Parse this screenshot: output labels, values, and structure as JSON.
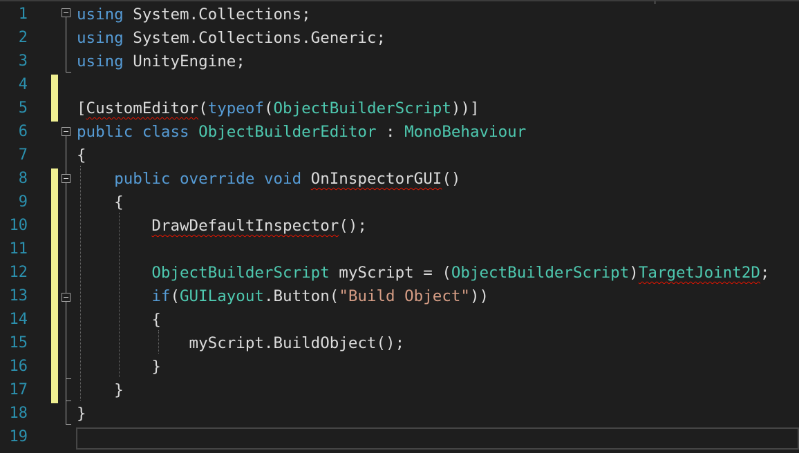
{
  "editor": {
    "colors": {
      "background": "#1e1e1e",
      "line_number": "#2b91af",
      "keyword": "#569cd6",
      "type": "#4ec9b0",
      "string": "#d69d85",
      "text": "#dcdcdc",
      "change_marker": "#efef91",
      "error_squiggle": "#e51400"
    },
    "lines": [
      {
        "num": "1",
        "tokens": [
          {
            "t": "using",
            "c": "kw"
          },
          {
            "t": " System.Collections;",
            "c": "pl"
          }
        ]
      },
      {
        "num": "2",
        "tokens": [
          {
            "t": "using",
            "c": "kw"
          },
          {
            "t": " System.Collections.Generic;",
            "c": "pl"
          }
        ]
      },
      {
        "num": "3",
        "tokens": [
          {
            "t": "using",
            "c": "kw"
          },
          {
            "t": " UnityEngine;",
            "c": "pl"
          }
        ]
      },
      {
        "num": "4",
        "tokens": []
      },
      {
        "num": "5",
        "tokens": [
          {
            "t": "[",
            "c": "pl"
          },
          {
            "t": "CustomEditor",
            "c": "pl",
            "err": true
          },
          {
            "t": "(",
            "c": "pl"
          },
          {
            "t": "typeof",
            "c": "kw"
          },
          {
            "t": "(",
            "c": "pl"
          },
          {
            "t": "ObjectBuilderScript",
            "c": "ty"
          },
          {
            "t": "))]",
            "c": "pl"
          }
        ]
      },
      {
        "num": "6",
        "tokens": [
          {
            "t": "public",
            "c": "kw"
          },
          {
            "t": " ",
            "c": "pl"
          },
          {
            "t": "class",
            "c": "kw"
          },
          {
            "t": " ",
            "c": "pl"
          },
          {
            "t": "ObjectBuilderEditor",
            "c": "ty"
          },
          {
            "t": " : ",
            "c": "pl"
          },
          {
            "t": "MonoBehaviour",
            "c": "ty"
          }
        ]
      },
      {
        "num": "7",
        "tokens": [
          {
            "t": "{",
            "c": "pl"
          }
        ]
      },
      {
        "num": "8",
        "tokens": [
          {
            "t": "    ",
            "c": "pl"
          },
          {
            "t": "public",
            "c": "kw"
          },
          {
            "t": " ",
            "c": "pl"
          },
          {
            "t": "override",
            "c": "kw"
          },
          {
            "t": " ",
            "c": "pl"
          },
          {
            "t": "void",
            "c": "kw"
          },
          {
            "t": " ",
            "c": "pl"
          },
          {
            "t": "OnInspectorGUI",
            "c": "pl",
            "err": true
          },
          {
            "t": "()",
            "c": "pl"
          }
        ]
      },
      {
        "num": "9",
        "tokens": [
          {
            "t": "    {",
            "c": "pl"
          }
        ]
      },
      {
        "num": "10",
        "tokens": [
          {
            "t": "        ",
            "c": "pl"
          },
          {
            "t": "DrawDefaultInspector",
            "c": "pl",
            "err": true
          },
          {
            "t": "();",
            "c": "pl"
          }
        ]
      },
      {
        "num": "11",
        "tokens": []
      },
      {
        "num": "12",
        "tokens": [
          {
            "t": "        ",
            "c": "pl"
          },
          {
            "t": "ObjectBuilderScript",
            "c": "ty"
          },
          {
            "t": " myScript = (",
            "c": "pl"
          },
          {
            "t": "ObjectBuilderScript",
            "c": "ty"
          },
          {
            "t": ")",
            "c": "pl"
          },
          {
            "t": "TargetJoint2D",
            "c": "ty",
            "err": true
          },
          {
            "t": ";",
            "c": "pl"
          }
        ]
      },
      {
        "num": "13",
        "tokens": [
          {
            "t": "        ",
            "c": "pl"
          },
          {
            "t": "if",
            "c": "kw"
          },
          {
            "t": "(",
            "c": "pl"
          },
          {
            "t": "GUILayout",
            "c": "ty"
          },
          {
            "t": ".Button(",
            "c": "pl"
          },
          {
            "t": "\"Build Object\"",
            "c": "str"
          },
          {
            "t": "))",
            "c": "pl"
          }
        ]
      },
      {
        "num": "14",
        "tokens": [
          {
            "t": "        {",
            "c": "pl"
          }
        ]
      },
      {
        "num": "15",
        "tokens": [
          {
            "t": "            myScript.BuildObject();",
            "c": "pl"
          }
        ]
      },
      {
        "num": "16",
        "tokens": [
          {
            "t": "        }",
            "c": "pl"
          }
        ]
      },
      {
        "num": "17",
        "tokens": [
          {
            "t": "    }",
            "c": "pl"
          }
        ]
      },
      {
        "num": "18",
        "tokens": [
          {
            "t": "}",
            "c": "pl"
          }
        ]
      },
      {
        "num": "19",
        "tokens": []
      }
    ]
  }
}
